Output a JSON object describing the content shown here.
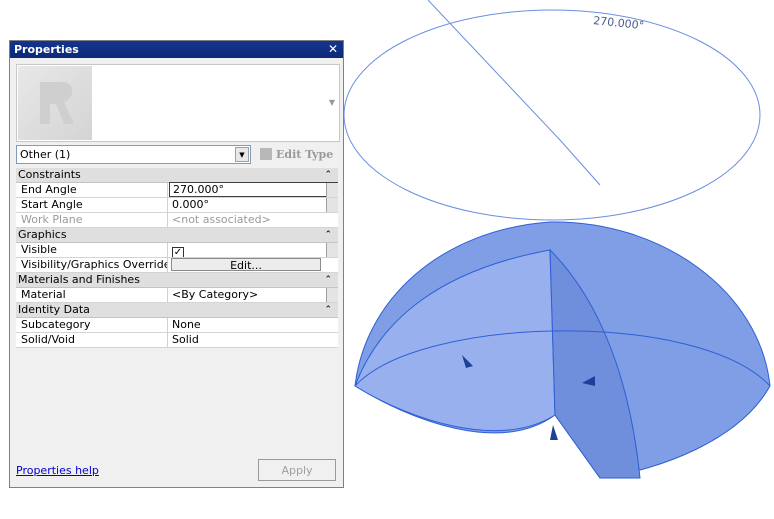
{
  "viewport": {
    "angle_annotation": "270.000°",
    "colors": {
      "solid_fill": "#7f9ee6",
      "edge": "#2e5fd6",
      "guide_line": "#6c8fe0"
    }
  },
  "properties": {
    "title": "Properties",
    "close_glyph": "✕",
    "type_selector": {
      "value": "Other (1)"
    },
    "edit_type_label": "Edit Type",
    "sections": [
      {
        "label": "Constraints",
        "rows": [
          {
            "name": "End Angle",
            "value": "270.000°"
          },
          {
            "name": "Start Angle",
            "value": "0.000°"
          },
          {
            "name": "Work Plane",
            "value": "<not associated>"
          }
        ]
      },
      {
        "label": "Graphics",
        "rows": [
          {
            "name": "Visible",
            "value": "✓"
          },
          {
            "name": "Visibility/Graphics Overrides",
            "value": "Edit..."
          }
        ]
      },
      {
        "label": "Materials and Finishes",
        "rows": [
          {
            "name": "Material",
            "value": "<By Category>"
          }
        ]
      },
      {
        "label": "Identity Data",
        "rows": [
          {
            "name": "Subcategory",
            "value": "None"
          },
          {
            "name": "Solid/Void",
            "value": "Solid"
          }
        ]
      }
    ],
    "help_link": "Properties help",
    "apply_label": "Apply"
  }
}
